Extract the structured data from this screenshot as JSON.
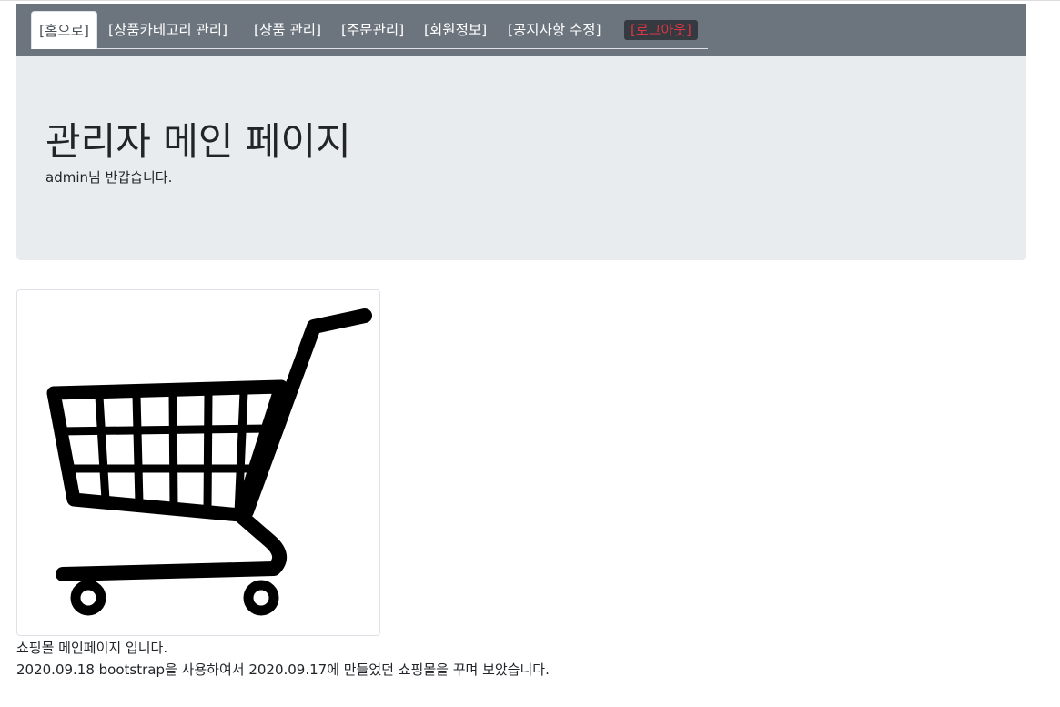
{
  "nav": {
    "home": "[홈으로]",
    "category": "[상품카테고리 관리]",
    "product": "[상품 관리]",
    "order": "[주문관리]",
    "member": "[회원정보]",
    "notice": "[공지사항 수정]",
    "logout": "[로그아웃]"
  },
  "jumbotron": {
    "title": "관리자 메인 페이지",
    "subtitle": "admin님 반갑습니다."
  },
  "image": {
    "icon": "shopping-cart-icon"
  },
  "content": {
    "line1": "쇼핑몰 메인페이지 입니다.",
    "line2": "2020.09.18 bootstrap을 사용하여서 2020.09.17에 만들었던 쇼핑몰을 꾸며 보았습니다."
  },
  "colors": {
    "navbar": "#6c757d",
    "jumbotron": "#e9ecef",
    "logout_text": "#dc3545",
    "logout_bg": "#343a40"
  }
}
